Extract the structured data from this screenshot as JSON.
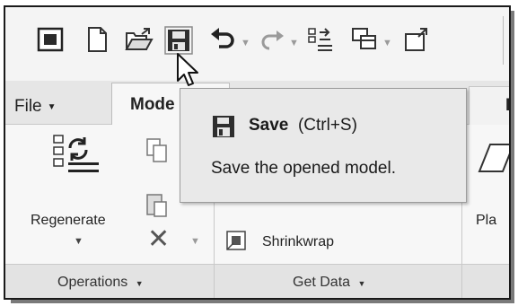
{
  "toolbar": {
    "icons": [
      "window-icon",
      "new-icon",
      "open-icon",
      "save-icon",
      "undo-icon",
      "redo-icon",
      "regenerate-icon",
      "windows-icon",
      "close-icon"
    ]
  },
  "tabs": {
    "file": "File",
    "model": "Mode",
    "right": "Re"
  },
  "ribbon": {
    "regenerate_label": "Regenerate",
    "shrinkwrap_label": "Shrinkwrap",
    "plane_label": "Pla",
    "groups": {
      "operations": "Operations",
      "get_data": "Get Data"
    }
  },
  "tooltip": {
    "title": "Save",
    "shortcut": "(Ctrl+S)",
    "description": "Save the opened model."
  },
  "colors": {
    "icon_dark": "#2b2b2b",
    "tooltip_bg": "#e9e9e9"
  }
}
